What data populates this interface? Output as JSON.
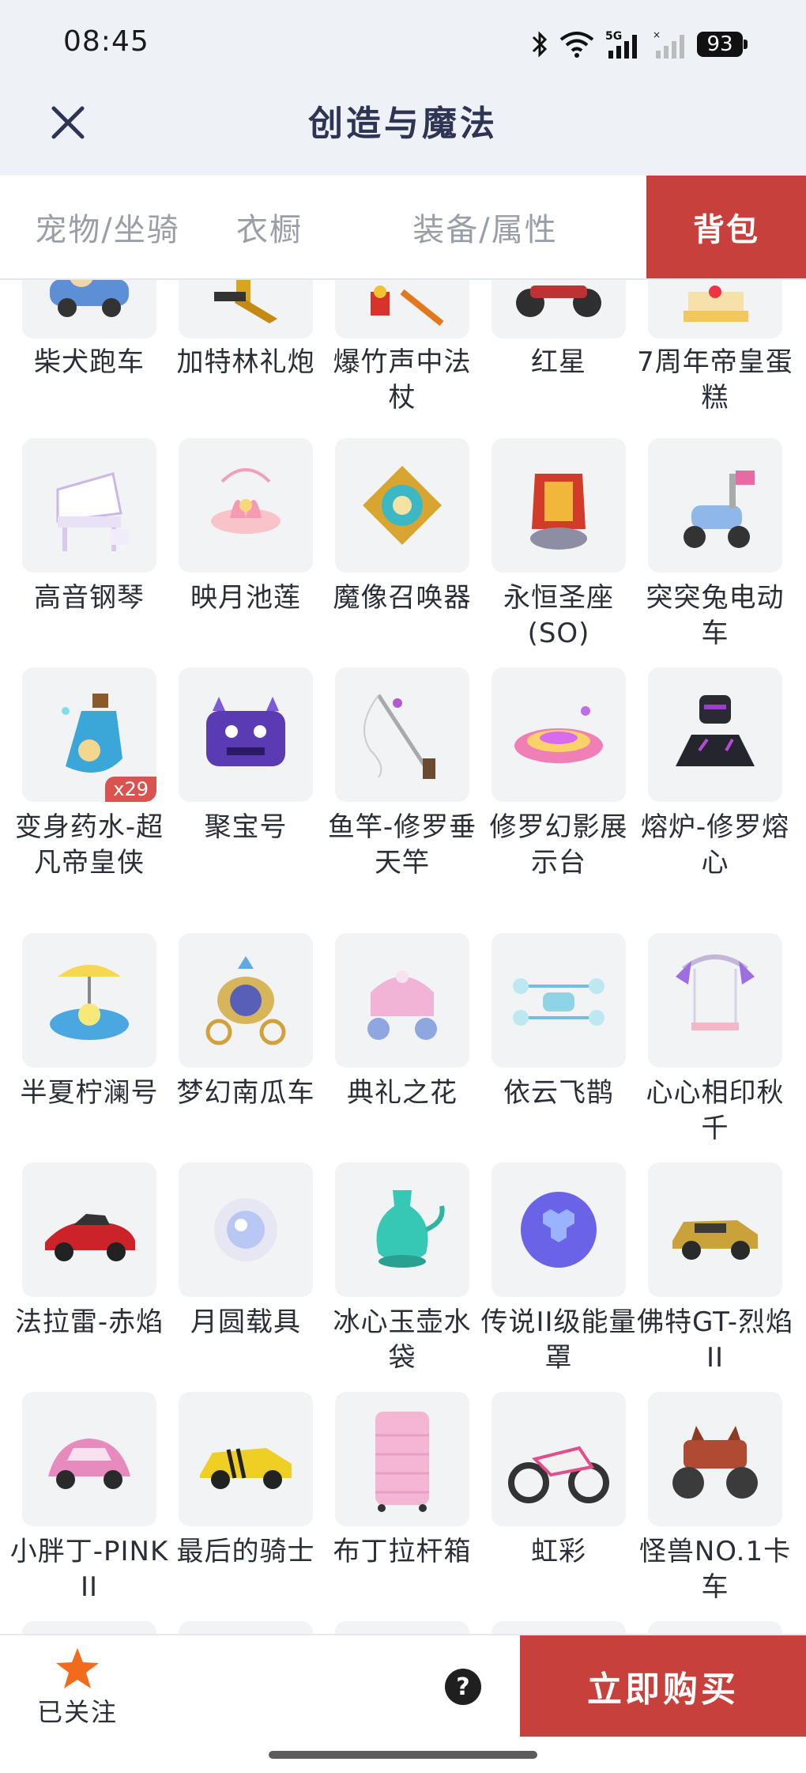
{
  "status_bar": {
    "time": "08:45",
    "network_label": "5G",
    "battery": "93",
    "icons": [
      "bluetooth-icon",
      "wifi-icon",
      "signal-5g-icon",
      "signal-empty-icon",
      "battery-icon"
    ]
  },
  "header": {
    "title": "创造与魔法",
    "close_icon": "close-icon"
  },
  "tabs": [
    {
      "label": "宠物/坐骑",
      "active": false
    },
    {
      "label": "衣橱",
      "active": false
    },
    {
      "label": "装备/属性",
      "active": false
    },
    {
      "label": "背包",
      "active": true
    }
  ],
  "colors": {
    "accent": "#c8403b",
    "header_bg": "#eef2f7",
    "title": "#2e3453",
    "tab_inactive": "#9a9ea6",
    "thumb_bg": "#f2f3f5",
    "star": "#f26b1d"
  },
  "items": [
    {
      "name": "柴犬跑车",
      "icon": "car-icon"
    },
    {
      "name": "加特林礼炮",
      "icon": "cannon-icon"
    },
    {
      "name": "爆竹声中法杖",
      "icon": "staff-icon"
    },
    {
      "name": "红星",
      "icon": "motorbike-icon"
    },
    {
      "name": "7周年帝皇蛋糕",
      "icon": "cake-icon"
    },
    {
      "name": "高音钢琴",
      "icon": "piano-icon"
    },
    {
      "name": "映月池莲",
      "icon": "lotus-icon"
    },
    {
      "name": "魔像召唤器",
      "icon": "summoner-icon"
    },
    {
      "name": "永恒圣座(SO)",
      "icon": "throne-icon"
    },
    {
      "name": "突突兔电动车",
      "icon": "scooter-icon"
    },
    {
      "name": "变身药水-超凡帝皇侠",
      "icon": "potion-icon",
      "quantity": "x29"
    },
    {
      "name": "聚宝号",
      "icon": "monster-vehicle-icon"
    },
    {
      "name": "鱼竿-修罗垂天竿",
      "icon": "fishing-rod-icon"
    },
    {
      "name": "修罗幻影展示台",
      "icon": "display-stand-icon"
    },
    {
      "name": "熔炉-修罗熔心",
      "icon": "furnace-icon"
    },
    {
      "name": "半夏柠澜号",
      "icon": "boat-icon"
    },
    {
      "name": "梦幻南瓜车",
      "icon": "carriage-icon"
    },
    {
      "name": "典礼之花",
      "icon": "flower-carriage-icon"
    },
    {
      "name": "依云飞鹊",
      "icon": "drone-icon"
    },
    {
      "name": "心心相印秋千",
      "icon": "swing-icon"
    },
    {
      "name": "法拉雷-赤焰",
      "icon": "sports-car-icon"
    },
    {
      "name": "月圆载具",
      "icon": "moon-orb-icon"
    },
    {
      "name": "冰心玉壶水袋",
      "icon": "jade-pot-icon"
    },
    {
      "name": "传说II级能量罩",
      "icon": "energy-shield-icon"
    },
    {
      "name": "佛特GT-烈焰II",
      "icon": "vintage-car-icon"
    },
    {
      "name": "小胖丁-PINK II",
      "icon": "beetle-car-icon"
    },
    {
      "name": "最后的骑士",
      "icon": "muscle-car-icon"
    },
    {
      "name": "布丁拉杆箱",
      "icon": "suitcase-icon"
    },
    {
      "name": "虹彩",
      "icon": "sport-bike-icon"
    },
    {
      "name": "怪兽NO.1卡车",
      "icon": "monster-truck-icon"
    }
  ],
  "bottom_bar": {
    "follow_label": "已关注",
    "help_label": "?",
    "buy_label": "立即购买"
  }
}
